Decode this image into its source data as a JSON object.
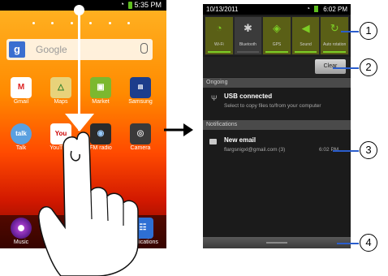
{
  "left_phone": {
    "status_time": "5:35 PM",
    "search_placeholder": "Google",
    "google_logo": "g",
    "apps": [
      {
        "label": "Gmail",
        "icon": "gmail-icon",
        "color": "#ffffff"
      },
      {
        "label": "Maps",
        "icon": "maps-icon",
        "color": "#e8d27a"
      },
      {
        "label": "Market",
        "icon": "market-icon",
        "color": "#7cb82f"
      },
      {
        "label": "Samsung",
        "icon": "samsung-icon",
        "color": "#1c3d8c"
      },
      {
        "label": "Talk",
        "icon": "talk-icon",
        "color": "#5aa0e0"
      },
      {
        "label": "YouTube",
        "icon": "youtube-icon",
        "color": "#ffffff"
      },
      {
        "label": "FM radio",
        "icon": "fm-radio-icon",
        "color": "#2b2b2b"
      },
      {
        "label": "Camera",
        "icon": "camera-icon",
        "color": "#3a3a3a"
      }
    ],
    "dock": [
      {
        "label": "Music",
        "icon": "music-icon"
      },
      {
        "label": "Applications",
        "icon": "applications-icon"
      }
    ]
  },
  "right_phone": {
    "status_date": "10/13/2011",
    "status_time": "6:02 PM",
    "toggles": [
      {
        "label": "Wi-Fi",
        "icon": "wifi-icon",
        "state": "on"
      },
      {
        "label": "Bluetooth",
        "icon": "bluetooth-icon",
        "state": "off"
      },
      {
        "label": "GPS",
        "icon": "gps-icon",
        "state": "on"
      },
      {
        "label": "Sound",
        "icon": "sound-icon",
        "state": "on"
      },
      {
        "label": "Auto rotation",
        "icon": "rotate-icon",
        "state": "on"
      }
    ],
    "clear_label": "Clear",
    "ongoing_header": "Ongoing",
    "usb_title": "USB connected",
    "usb_sub": "Select to copy files to/from your computer",
    "notifications_header": "Notifications",
    "email_title": "New email",
    "email_sub": "flargsnigxl@gmail.com (3)",
    "email_time": "6:02 PM"
  },
  "callouts": [
    "1",
    "2",
    "3",
    "4"
  ],
  "colors": {
    "accent_on": "#7ccd25",
    "callout_line": "#2a5dcc"
  }
}
